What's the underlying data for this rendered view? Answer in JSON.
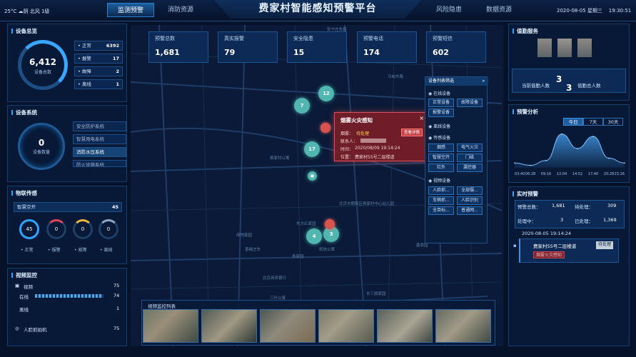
{
  "header": {
    "weather": "25°C ☁阴 北风 1级",
    "title": "费家村智能感知预警平台",
    "nav": [
      "监测预警",
      "消防资源",
      "风险隐患",
      "数据资源"
    ],
    "datetime": "2020-08-05 星期三    19:30:51"
  },
  "device_overview": {
    "title": "设备总览",
    "total": "6,412",
    "total_label": "设备总数",
    "stats": [
      {
        "label": "正常",
        "value": "6392"
      },
      {
        "label": "报警",
        "value": "17"
      },
      {
        "label": "故障",
        "value": "2"
      },
      {
        "label": "离线",
        "value": "1"
      }
    ]
  },
  "device_system": {
    "title": "设备系统",
    "count": "0",
    "count_label": "设备数量",
    "items": [
      "安全防护系统",
      "智慧用电系统",
      "消防水压系统",
      "防火设施系统"
    ]
  },
  "iot": {
    "title": "物联传感",
    "sub": "智慧空开",
    "sub_value": "45",
    "gauges": [
      "45",
      "0",
      "0",
      "0"
    ],
    "legend": [
      "正常",
      "报警",
      "故障",
      "离线"
    ]
  },
  "video": {
    "title": "视频监控",
    "label": "视频",
    "value": "75",
    "online_label": "在线",
    "online_value": "74",
    "online_ratio": 0.99,
    "offline_label": "离线",
    "offline_value": "1",
    "face_label": "人脸抓拍机",
    "face_value": "75"
  },
  "stats": [
    {
      "label": "预警总数",
      "value": "1,681"
    },
    {
      "label": "真实报警",
      "value": "79"
    },
    {
      "label": "安全隐患",
      "value": "15"
    },
    {
      "label": "预警电话",
      "value": "174"
    },
    {
      "label": "预警短信",
      "value": "602"
    }
  ],
  "map": {
    "bubbles": [
      "12",
      "7",
      "17",
      "4",
      "3"
    ],
    "labels": [
      "安宁庄东路",
      "马甸东路",
      "费家村公寓",
      "北京市朝阳区费家村中心幼儿园",
      "东方红家园",
      "和信公寓",
      "绿地家园",
      "北京商务银行",
      "三叶公寓",
      "东三旗家园",
      "香格庄东",
      "塞翁园",
      "贵家园"
    ]
  },
  "popup": {
    "title": "烟雾火灾感知",
    "status_label": "烟雾：",
    "status_value": "待处理",
    "contact_label": "联系人：",
    "time_label": "时间：",
    "time_value": "2020/08/09 19:14:24",
    "location_label": "位置：",
    "location_value": "费家村55号二层楼道",
    "detail_button": "查看详情"
  },
  "filter": {
    "title": "设备列表筛选",
    "online_header": "在线设备",
    "online": [
      "正常设备",
      "故障设备",
      "报警设备"
    ],
    "offline_header": "离线设备",
    "sensor_header": "传感设备",
    "sensors": [
      "烟感",
      "电气火灾",
      "智慧空开",
      "门磁",
      "红外",
      "漏控器"
    ],
    "video_header": "视频设备",
    "videos": [
      "人脸抓...",
      "全部摄...",
      "车辆抓...",
      "人脸识别",
      "全目标...",
      "普通网..."
    ]
  },
  "video_list": {
    "title": "视频监控列表"
  },
  "duty": {
    "title": "值勤服务",
    "current_label": "当前值勤人数",
    "current": "3",
    "total": "3",
    "total_label": "值勤总人数"
  },
  "forecast": {
    "title": "预警分析",
    "tabs": [
      "今日",
      "7天",
      "30天"
    ],
    "x_labels": [
      "03:40",
      "06:28",
      "09:16",
      "12:04",
      "14:52",
      "17:40",
      "20:28",
      "23:16"
    ]
  },
  "chart_data": {
    "type": "area",
    "title": "预警分析",
    "x": [
      "03:40",
      "06:28",
      "09:16",
      "12:04",
      "14:52",
      "17:40",
      "20:28",
      "23:16"
    ],
    "series": [
      {
        "values": [
          2,
          1,
          3,
          14,
          8,
          13,
          4,
          2
        ]
      }
    ],
    "color": "#3f8fd8"
  },
  "realtime": {
    "title": "实时预警",
    "total_label": "预警总数：",
    "total_value": "1,681",
    "pending_label": "待处理：",
    "pending_value": "309",
    "processing_label": "处理中：",
    "processing_value": "3",
    "done_label": "已处理：",
    "done_value": "1,369",
    "timestamp": "2020-08-05 19:14:24",
    "event_location": "费家村55号二层楼道",
    "event_type": "烟雾火灾感知",
    "event_button": "待处理"
  },
  "colors": {
    "accent": "#2fa4ff",
    "alarm": "#d9534f",
    "bubble": "#5ac8be"
  }
}
